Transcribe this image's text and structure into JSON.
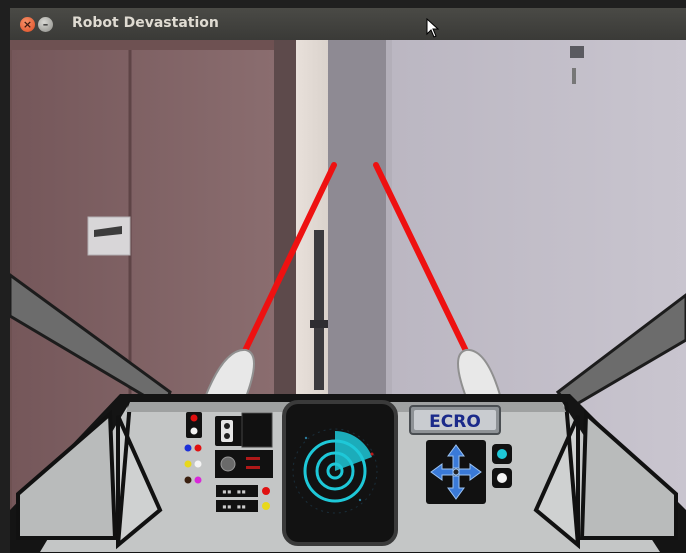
{
  "window": {
    "title": "Robot Devastation",
    "close_glyph": "×",
    "minimize_glyph": "–"
  },
  "hud": {
    "logo_text": "ECRO",
    "laser_color": "#ee1111",
    "radar_color": "#1ec8d8",
    "panel_color": "#c4c6c6"
  }
}
